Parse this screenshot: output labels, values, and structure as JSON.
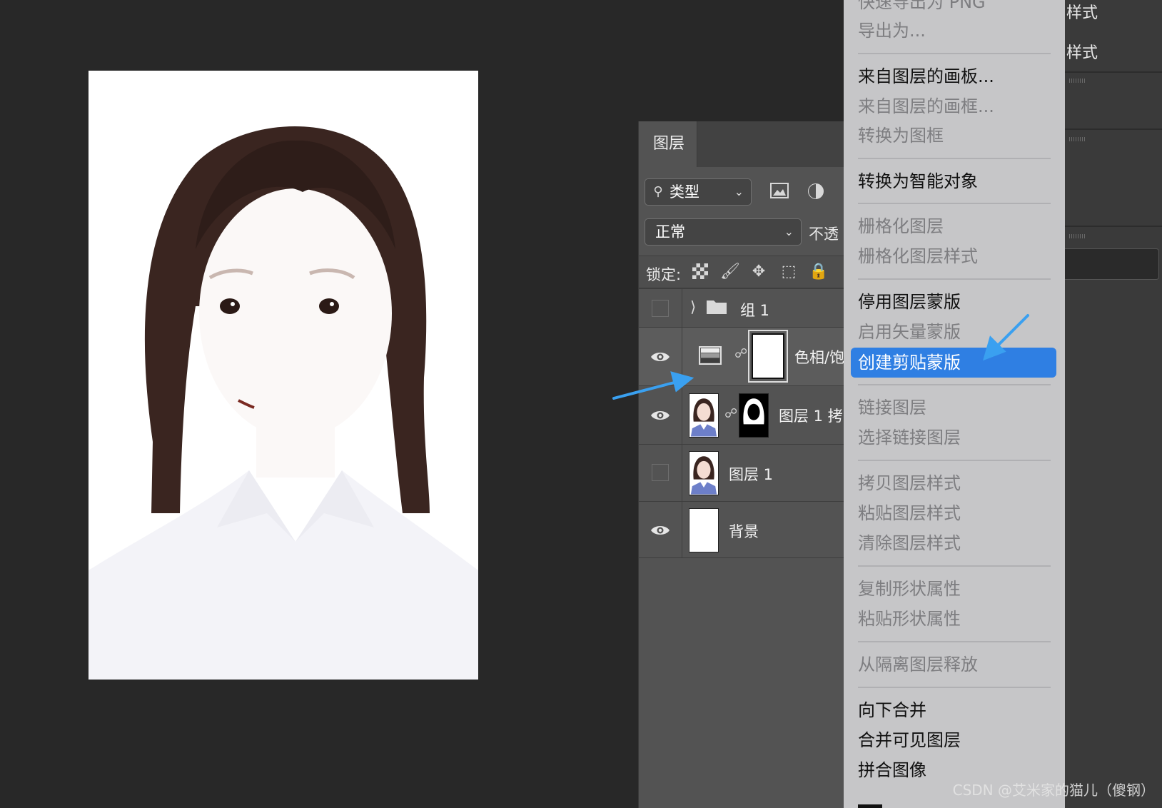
{
  "layers_panel": {
    "tab_label": "图层",
    "filter": {
      "value": "类型"
    },
    "blend_mode": "正常",
    "opacity_label": "不透",
    "lock_label": "锁定:",
    "layers": [
      {
        "name": "组 1",
        "visible": false,
        "kind": "group"
      },
      {
        "name": "色相/饱",
        "visible": true,
        "kind": "adjustment"
      },
      {
        "name": "图层 1 拷",
        "visible": true,
        "kind": "masked-photo"
      },
      {
        "name": "图层 1",
        "visible": false,
        "kind": "photo"
      },
      {
        "name": "背景",
        "visible": true,
        "kind": "background"
      }
    ]
  },
  "context_menu": {
    "items": [
      {
        "label": "快速导出为 PNG",
        "enabled": false
      },
      {
        "label": "导出为...",
        "enabled": false
      },
      {
        "label": "来自图层的画板...",
        "enabled": true
      },
      {
        "label": "来自图层的画框...",
        "enabled": false
      },
      {
        "label": "转换为图框",
        "enabled": false
      },
      {
        "label": "转换为智能对象",
        "enabled": true
      },
      {
        "label": "栅格化图层",
        "enabled": false
      },
      {
        "label": "栅格化图层样式",
        "enabled": false
      },
      {
        "label": "停用图层蒙版",
        "enabled": true
      },
      {
        "label": "启用矢量蒙版",
        "enabled": false
      },
      {
        "label": "创建剪贴蒙版",
        "enabled": true,
        "selected": true
      },
      {
        "label": "链接图层",
        "enabled": false
      },
      {
        "label": "选择链接图层",
        "enabled": false
      },
      {
        "label": "拷贝图层样式",
        "enabled": false
      },
      {
        "label": "粘贴图层样式",
        "enabled": false
      },
      {
        "label": "清除图层样式",
        "enabled": false
      },
      {
        "label": "复制形状属性",
        "enabled": false
      },
      {
        "label": "粘贴形状属性",
        "enabled": false
      },
      {
        "label": "从隔离图层释放",
        "enabled": false
      },
      {
        "label": "向下合并",
        "enabled": true
      },
      {
        "label": "合并可见图层",
        "enabled": true
      },
      {
        "label": "拼合图像",
        "enabled": true
      }
    ],
    "highlight_color": "#2f7fe3"
  },
  "right_panel": {
    "labels": [
      "样式",
      "样式"
    ]
  },
  "annotations": {
    "arrow_color": "#3aa0f0"
  },
  "watermark": "CSDN @艾米家的猫儿（傻钢）"
}
